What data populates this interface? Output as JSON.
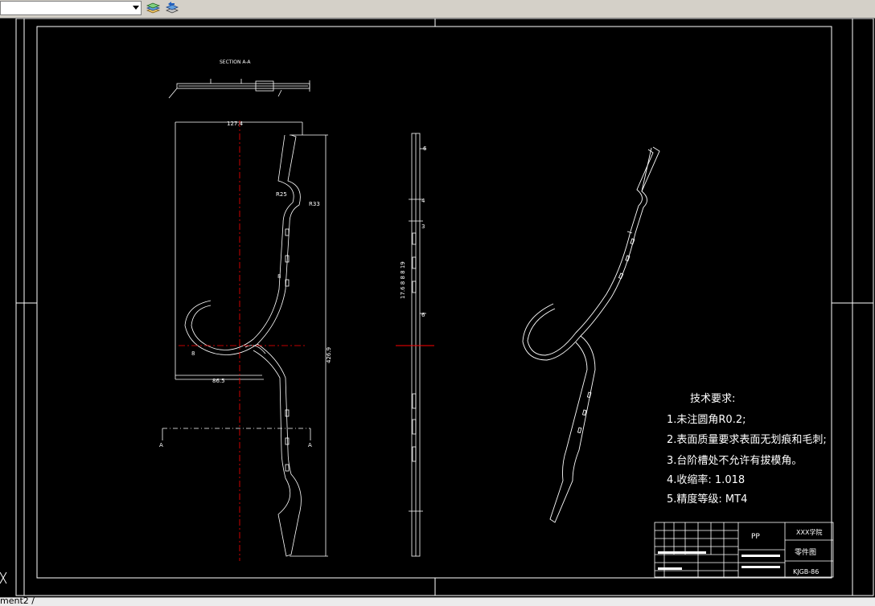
{
  "toolbar": {
    "layer_dropdown_value": "",
    "layer_states_icon": "layer-states-icon",
    "layer_previous_icon": "layer-previous-icon"
  },
  "drawing": {
    "section_label": "SECTION A-A",
    "dims": {
      "width_127": "127.4",
      "r25": "R25",
      "r33": "R33",
      "d8_left": "8",
      "r_small": "8",
      "d86": "86.5",
      "d426": "426.9",
      "a_left": "A",
      "a_right": "A",
      "side_6a": "6",
      "side_4": "4",
      "side_3": "3",
      "side_6b": "6",
      "side_stack": "17.6 8 8 8 19"
    },
    "notes": {
      "title": "技术要求:",
      "items": [
        "1.未注圆角R0.2;",
        "2.表面质量要求表面无划痕和毛刺;",
        "3.台阶槽处不允许有拔模角。",
        "4.收缩率: 1.018",
        "5.精度等级: MT4"
      ]
    },
    "title_block": {
      "material": "PP",
      "school": "XXX学院",
      "part_name": "零件图",
      "drawing_no": "KJGB-86"
    }
  },
  "tabbar": {
    "label": "ment2 /"
  },
  "colors": {
    "background": "#000000",
    "lines": "#ffffff",
    "centerline": "#ff0000",
    "toolbar": "#d4d0c8"
  }
}
